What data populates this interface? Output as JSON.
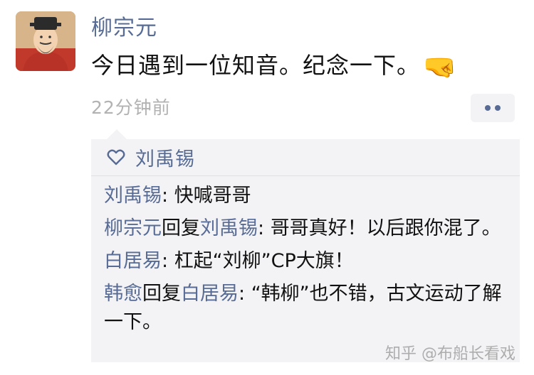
{
  "post": {
    "author": "柳宗元",
    "content": "今日遇到一位知音。纪念一下。",
    "emoji": "🤜",
    "time": "22分钟前"
  },
  "likes": {
    "names": "刘禹锡"
  },
  "comments": [
    {
      "user": "刘禹锡",
      "reply_label": "",
      "reply_to": "",
      "sep": ": ",
      "text": "快喊哥哥"
    },
    {
      "user": "柳宗元",
      "reply_label": "回复",
      "reply_to": "刘禹锡",
      "sep": ": ",
      "text": "哥哥真好！以后跟你混了。"
    },
    {
      "user": "白居易",
      "reply_label": "",
      "reply_to": "",
      "sep": ": ",
      "text": "杠起“刘柳”CP大旗！"
    },
    {
      "user": "韩愈",
      "reply_label": "回复",
      "reply_to": "白居易",
      "sep": ": ",
      "text": "“韩柳”也不错，古文运动了解一下。"
    }
  ],
  "watermark": "知乎 @布船长看戏",
  "colors": {
    "link": "#576b95",
    "comment_bg": "#f3f3f5",
    "time": "#b2b2b2"
  }
}
